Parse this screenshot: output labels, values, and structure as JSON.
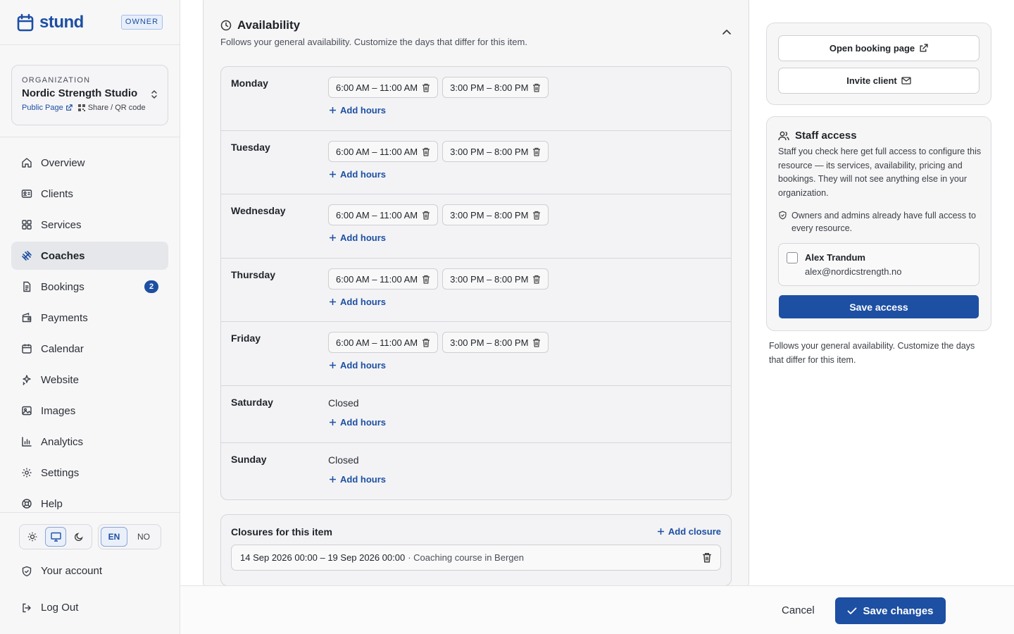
{
  "brand": {
    "name": "stund",
    "role_badge": "OWNER"
  },
  "organization": {
    "label": "ORGANIZATION",
    "name": "Nordic Strength Studio",
    "public_page": "Public Page",
    "share": "Share / QR code"
  },
  "nav": {
    "items": [
      {
        "label": "Overview",
        "icon": "home-icon"
      },
      {
        "label": "Clients",
        "icon": "id-card-icon"
      },
      {
        "label": "Services",
        "icon": "grid-icon"
      },
      {
        "label": "Coaches",
        "icon": "dumbbell-icon",
        "active": true
      },
      {
        "label": "Bookings",
        "icon": "document-icon",
        "badge": "2"
      },
      {
        "label": "Payments",
        "icon": "wallet-icon"
      },
      {
        "label": "Calendar",
        "icon": "calendar-icon"
      },
      {
        "label": "Website",
        "icon": "sparkle-icon"
      },
      {
        "label": "Images",
        "icon": "image-icon"
      },
      {
        "label": "Analytics",
        "icon": "bar-chart-icon"
      },
      {
        "label": "Settings",
        "icon": "gear-icon"
      },
      {
        "label": "Help",
        "icon": "lifebuoy-icon"
      }
    ]
  },
  "preferences": {
    "theme": "system",
    "languages": [
      "EN",
      "NO"
    ],
    "selected_language": "EN"
  },
  "account": {
    "your_account": "Your account",
    "log_out": "Log Out"
  },
  "availability": {
    "title": "Availability",
    "subtitle": "Follows your general availability. Customize the days that differ for this item.",
    "add_hours": "Add hours",
    "days": [
      {
        "name": "Monday",
        "slots": [
          "6:00 AM – 11:00 AM",
          "3:00 PM – 8:00 PM"
        ]
      },
      {
        "name": "Tuesday",
        "slots": [
          "6:00 AM – 11:00 AM",
          "3:00 PM – 8:00 PM"
        ]
      },
      {
        "name": "Wednesday",
        "slots": [
          "6:00 AM – 11:00 AM",
          "3:00 PM – 8:00 PM"
        ]
      },
      {
        "name": "Thursday",
        "slots": [
          "6:00 AM – 11:00 AM",
          "3:00 PM – 8:00 PM"
        ]
      },
      {
        "name": "Friday",
        "slots": [
          "6:00 AM – 11:00 AM",
          "3:00 PM – 8:00 PM"
        ]
      },
      {
        "name": "Saturday",
        "closed": "Closed"
      },
      {
        "name": "Sunday",
        "closed": "Closed"
      }
    ]
  },
  "closures": {
    "title": "Closures for this item",
    "add_label": "Add closure",
    "items": [
      {
        "dates": "14 Sep 2026 00:00 – 19 Sep 2026 00:00",
        "description": "· Coaching course in Bergen"
      }
    ]
  },
  "actions": {
    "open_booking": "Open booking page",
    "invite_client": "Invite client"
  },
  "staff_access": {
    "title": "Staff access",
    "description": "Staff you check here get full access to configure this resource — its services, availability, pricing and bookings. They will not see anything else in your organization.",
    "note": "Owners and admins already have full access to every resource.",
    "members": [
      {
        "name": "Alex Trandum",
        "email": "alex@nordicstrength.no",
        "checked": false
      }
    ],
    "save_label": "Save access"
  },
  "right_note": "Follows your general availability. Customize the days that differ for this item.",
  "footer": {
    "cancel": "Cancel",
    "save": "Save changes"
  },
  "colors": {
    "accent": "#1d4fa3",
    "sidebar_bg": "#f7f7f8",
    "card_bg": "#f6f6f7"
  }
}
